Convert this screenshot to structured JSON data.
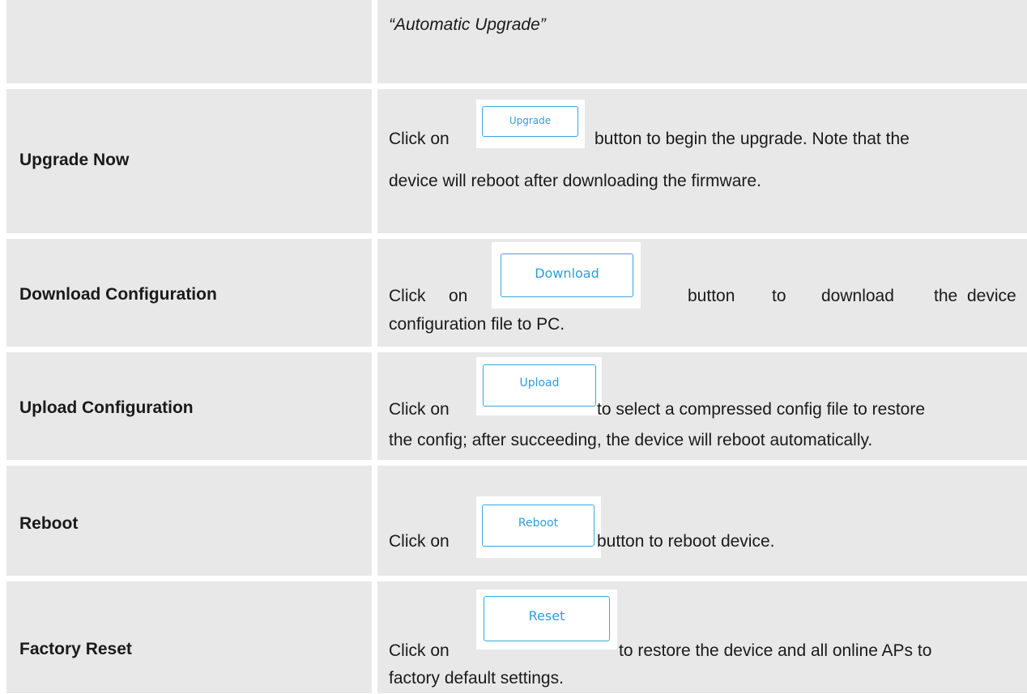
{
  "rows": [
    {
      "label": "",
      "desc_line1": "“Automatic Upgrade”"
    },
    {
      "label": "Upgrade Now",
      "desc_pre": "Click on",
      "button": "Upgrade",
      "desc_post": "button to begin the upgrade. Note that the",
      "desc_line2": "device will reboot after downloading the firmware."
    },
    {
      "label": "Download Configuration",
      "desc_pre": "Click",
      "desc_pre2": "on",
      "button": "Download",
      "desc_post_words": [
        "button",
        "to",
        "download",
        "the",
        "device"
      ],
      "desc_line2": "configuration file to PC."
    },
    {
      "label": "Upload Configuration",
      "desc_pre": "Click on",
      "button": "Upload",
      "desc_post": "to select a compressed config file to restore",
      "desc_line2": "the config; after succeeding, the device will reboot automatically."
    },
    {
      "label": "Reboot",
      "desc_pre": "Click on",
      "button": "Reboot",
      "desc_post": "button to reboot device."
    },
    {
      "label": "Factory Reset",
      "desc_pre": "Click on",
      "button": "Reset",
      "desc_post": "to restore the device and all online APs to",
      "desc_line2": "factory default settings."
    }
  ],
  "colors": {
    "cell_bg": "#e8e8e8",
    "button_border": "#38a8dc",
    "button_text": "#2d9ed6"
  }
}
